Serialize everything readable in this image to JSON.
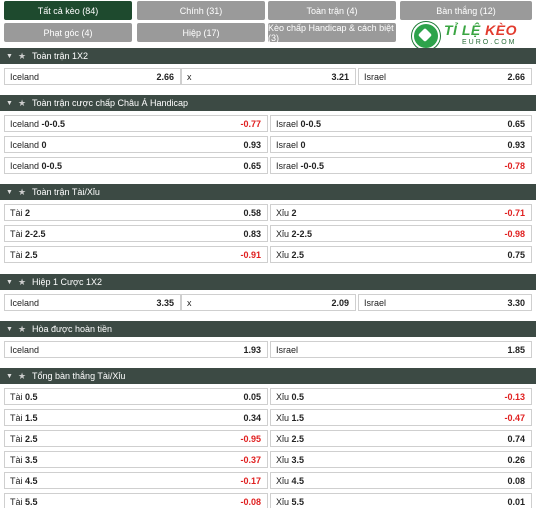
{
  "tabs": [
    {
      "label": "Tất cả kèo (84)",
      "active": true
    },
    {
      "label": "Chính (31)"
    },
    {
      "label": "Toàn trận (4)"
    },
    {
      "label": "Bàn thắng (12)"
    },
    {
      "label": "Phạt góc (4)"
    },
    {
      "label": "Hiệp (17)"
    },
    {
      "label": "Kèo chấp Handicap & cách biệt (3)"
    }
  ],
  "logo": {
    "part1": "TỈ LỆ ",
    "part2": "KÈO",
    "sub": "EURO.COM"
  },
  "colors": {
    "header_bg": "#3c4a44",
    "tab_bg": "#9a9a9a",
    "tab_active_bg": "#1e4a2e",
    "negative": "#e02020"
  },
  "sections": [
    {
      "title": "Toàn trận 1X2",
      "layout": "three",
      "rows": [
        [
          {
            "label": "Iceland",
            "odd": "2.66"
          },
          {
            "label": "x",
            "odd": "3.21"
          },
          {
            "label": "Israel",
            "odd": "2.66"
          }
        ]
      ]
    },
    {
      "title": "Toàn trận cược chấp Châu Á Handicap",
      "layout": "two",
      "rows": [
        [
          {
            "label": "Iceland",
            "line": "-0-0.5",
            "odd": "-0.77"
          },
          {
            "label": "Israel",
            "line": "0-0.5",
            "odd": "0.65"
          }
        ],
        [
          {
            "label": "Iceland",
            "line": "0",
            "odd": "0.93"
          },
          {
            "label": "Israel",
            "line": "0",
            "odd": "0.93"
          }
        ],
        [
          {
            "label": "Iceland",
            "line": "0-0.5",
            "odd": "0.65"
          },
          {
            "label": "Israel",
            "line": "-0-0.5",
            "odd": "-0.78"
          }
        ]
      ]
    },
    {
      "title": "Toàn trận Tài/Xỉu",
      "layout": "two",
      "rows": [
        [
          {
            "label": "Tài",
            "line": "2",
            "odd": "0.58"
          },
          {
            "label": "Xỉu",
            "line": "2",
            "odd": "-0.71"
          }
        ],
        [
          {
            "label": "Tài",
            "line": "2-2.5",
            "odd": "0.83"
          },
          {
            "label": "Xỉu",
            "line": "2-2.5",
            "odd": "-0.98"
          }
        ],
        [
          {
            "label": "Tài",
            "line": "2.5",
            "odd": "-0.91"
          },
          {
            "label": "Xỉu",
            "line": "2.5",
            "odd": "0.75"
          }
        ]
      ]
    },
    {
      "title": "Hiệp 1 Cược 1X2",
      "layout": "three",
      "rows": [
        [
          {
            "label": "Iceland",
            "odd": "3.35"
          },
          {
            "label": "x",
            "odd": "2.09"
          },
          {
            "label": "Israel",
            "odd": "3.30"
          }
        ]
      ]
    },
    {
      "title": "Hòa được hoàn tiền",
      "layout": "two",
      "rows": [
        [
          {
            "label": "Iceland",
            "odd": "1.93"
          },
          {
            "label": "Israel",
            "odd": "1.85"
          }
        ]
      ]
    },
    {
      "title": "Tổng bàn thắng Tài/Xỉu",
      "layout": "two",
      "rows": [
        [
          {
            "label": "Tài",
            "line": "0.5",
            "odd": "0.05"
          },
          {
            "label": "Xỉu",
            "line": "0.5",
            "odd": "-0.13"
          }
        ],
        [
          {
            "label": "Tài",
            "line": "1.5",
            "odd": "0.34"
          },
          {
            "label": "Xỉu",
            "line": "1.5",
            "odd": "-0.47"
          }
        ],
        [
          {
            "label": "Tài",
            "line": "2.5",
            "odd": "-0.95"
          },
          {
            "label": "Xỉu",
            "line": "2.5",
            "odd": "0.74"
          }
        ],
        [
          {
            "label": "Tài",
            "line": "3.5",
            "odd": "-0.37"
          },
          {
            "label": "Xỉu",
            "line": "3.5",
            "odd": "0.26"
          }
        ],
        [
          {
            "label": "Tài",
            "line": "4.5",
            "odd": "-0.17"
          },
          {
            "label": "Xỉu",
            "line": "4.5",
            "odd": "0.08"
          }
        ],
        [
          {
            "label": "Tài",
            "line": "5.5",
            "odd": "-0.08"
          },
          {
            "label": "Xỉu",
            "line": "5.5",
            "odd": "0.01"
          }
        ]
      ]
    }
  ]
}
